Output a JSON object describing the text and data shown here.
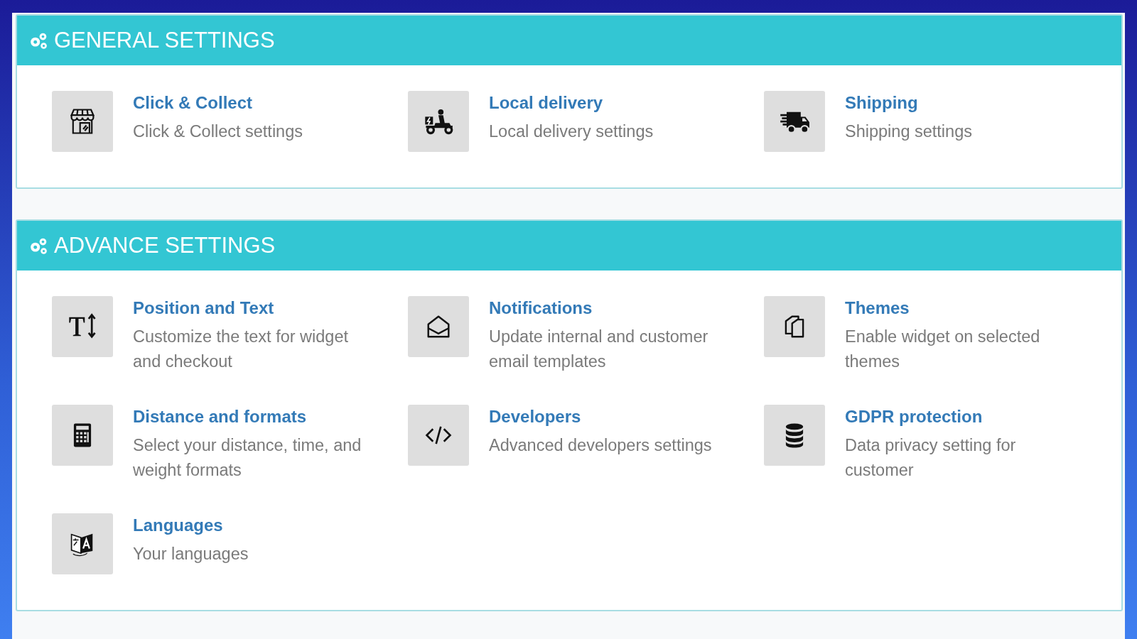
{
  "sections": [
    {
      "title": "GENERAL SETTINGS",
      "items": [
        {
          "title": "Click & Collect",
          "description": "Click & Collect settings"
        },
        {
          "title": "Local delivery",
          "description": "Local delivery settings"
        },
        {
          "title": "Shipping",
          "description": "Shipping settings"
        }
      ]
    },
    {
      "title": "ADVANCE SETTINGS",
      "items": [
        {
          "title": "Position and Text",
          "description": "Customize the text for widget and checkout"
        },
        {
          "title": "Notifications",
          "description": "Update internal and customer email templates"
        },
        {
          "title": "Themes",
          "description": "Enable widget on selected themes"
        },
        {
          "title": "Distance and formats",
          "description": "Select your distance, time, and weight formats"
        },
        {
          "title": "Developers",
          "description": "Advanced developers settings"
        },
        {
          "title": "GDPR protection",
          "description": "Data privacy setting for customer"
        },
        {
          "title": "Languages",
          "description": "Your languages"
        }
      ]
    }
  ]
}
